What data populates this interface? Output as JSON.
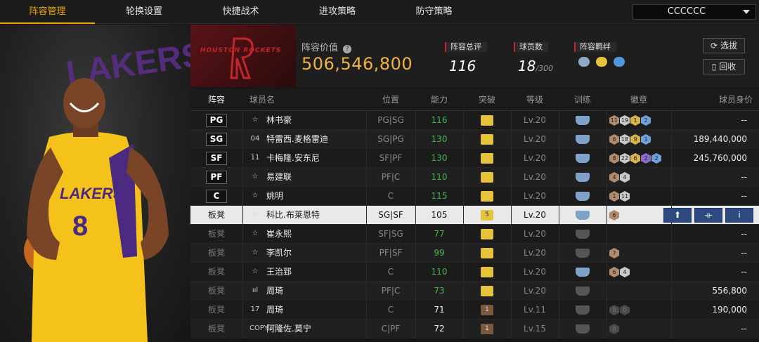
{
  "nav": {
    "tabs": [
      "阵容管理",
      "轮换设置",
      "快捷战术",
      "进攻策略",
      "防守策略"
    ],
    "active_tab": 0,
    "team_select": "CCCCCC"
  },
  "header": {
    "team_logo_text": "HOUSTON ROCKETS",
    "value_label": "阵容价值",
    "value": "506,546,800",
    "stats": [
      {
        "label": "阵容总评",
        "value": "116",
        "sub": ""
      },
      {
        "label": "球员数",
        "value": "18",
        "sub": "/300"
      },
      {
        "label": "阵容羁绊",
        "value": "",
        "sub": ""
      }
    ],
    "buttons": {
      "select": "选拔",
      "recycle": "回收"
    }
  },
  "table": {
    "columns": [
      "阵容",
      "球员名",
      "位置",
      "能力",
      "突破",
      "等级",
      "训练",
      "徽章",
      "球员身价"
    ],
    "rows": [
      {
        "slot": "PG",
        "starter": true,
        "icon": "☆",
        "name": "林书豪",
        "position": "PG|SG",
        "ability": "116",
        "ability_green": true,
        "break": "",
        "break_type": "gold",
        "level": "Lv.20",
        "train": "blue",
        "badges": [
          [
            "11",
            "b-bronze"
          ],
          [
            "19",
            "b-silver"
          ],
          [
            "1",
            "b-gold"
          ],
          [
            "2",
            "b-blue"
          ]
        ],
        "value": "--"
      },
      {
        "slot": "SG",
        "starter": true,
        "icon": "04",
        "name": "特雷西.麦格雷迪",
        "position": "SG|PG",
        "ability": "130",
        "ability_green": true,
        "break": "",
        "break_type": "gold",
        "level": "Lv.20",
        "train": "blue",
        "badges": [
          [
            "6",
            "b-bronze"
          ],
          [
            "18",
            "b-silver"
          ],
          [
            "9",
            "b-gold"
          ],
          [
            "1",
            "b-blue"
          ]
        ],
        "value": "189,440,000"
      },
      {
        "slot": "SF",
        "starter": true,
        "icon": "11",
        "name": "卡梅隆.安东尼",
        "position": "SF|PF",
        "ability": "130",
        "ability_green": true,
        "break": "",
        "break_type": "gold",
        "level": "Lv.20",
        "train": "blue",
        "badges": [
          [
            "8",
            "b-bronze"
          ],
          [
            "22",
            "b-silver"
          ],
          [
            "6",
            "b-gold"
          ],
          [
            "2",
            "b-purple"
          ],
          [
            "2",
            "b-blue"
          ]
        ],
        "value": "245,760,000"
      },
      {
        "slot": "PF",
        "starter": true,
        "icon": "☆",
        "name": "易建联",
        "position": "PF|C",
        "ability": "110",
        "ability_green": true,
        "break": "",
        "break_type": "gold",
        "level": "Lv.20",
        "train": "blue",
        "badges": [
          [
            "4",
            "b-bronze"
          ],
          [
            "4",
            "b-silver"
          ]
        ],
        "value": "--"
      },
      {
        "slot": "C",
        "starter": true,
        "icon": "☆",
        "name": "姚明",
        "position": "C",
        "ability": "115",
        "ability_green": true,
        "break": "",
        "break_type": "gold",
        "level": "Lv.20",
        "train": "blue",
        "badges": [
          [
            "1",
            "b-bronze"
          ],
          [
            "11",
            "b-silver"
          ]
        ],
        "value": "--"
      },
      {
        "slot": "板凳",
        "starter": false,
        "selected": true,
        "icon": "☆",
        "name": "科比.布莱恩特",
        "position": "SG|SF",
        "ability": "105",
        "ability_green": false,
        "break": "5",
        "break_type": "gold",
        "level": "Lv.20",
        "train": "blue",
        "badges": [
          [
            "6",
            "b-bronze"
          ]
        ],
        "value": ""
      },
      {
        "slot": "板凳",
        "starter": false,
        "icon": "☆",
        "name": "崔永熙",
        "position": "SF|SG",
        "ability": "77",
        "ability_green": true,
        "break": "",
        "break_type": "gold",
        "level": "Lv.20",
        "train": "gray",
        "badges": [],
        "value": "--"
      },
      {
        "slot": "板凳",
        "starter": false,
        "icon": "☆",
        "name": "李凯尔",
        "position": "PF|SF",
        "ability": "99",
        "ability_green": true,
        "break": "",
        "break_type": "gold",
        "level": "Lv.20",
        "train": "gray",
        "badges": [
          [
            "7",
            "b-bronze"
          ]
        ],
        "value": "--"
      },
      {
        "slot": "板凳",
        "starter": false,
        "icon": "☆",
        "name": "王治郅",
        "position": "C",
        "ability": "110",
        "ability_green": true,
        "break": "",
        "break_type": "gold",
        "level": "Lv.20",
        "train": "blue",
        "badges": [
          [
            "6",
            "b-bronze"
          ],
          [
            "4",
            "b-silver"
          ]
        ],
        "value": "--"
      },
      {
        "slot": "板凳",
        "starter": false,
        "icon": "ııl",
        "name": "周琦",
        "position": "PF|C",
        "ability": "73",
        "ability_green": true,
        "break": "",
        "break_type": "gold",
        "level": "Lv.20",
        "train": "gray",
        "badges": [],
        "value": "556,800"
      },
      {
        "slot": "板凳",
        "starter": false,
        "icon": "17",
        "name": "周琦",
        "position": "C",
        "ability": "71",
        "ability_green": false,
        "break": "1",
        "break_type": "brown",
        "level": "Lv.11",
        "train": "gray",
        "badges": [
          [
            "0",
            "b-dark"
          ],
          [
            "0",
            "b-dark"
          ]
        ],
        "value": "190,000"
      },
      {
        "slot": "板凳",
        "starter": false,
        "icon": "COPY",
        "name": "阿隆佐.莫宁",
        "position": "C|PF",
        "ability": "72",
        "ability_green": false,
        "break": "1",
        "break_type": "brown",
        "level": "Lv.15",
        "train": "gray",
        "badges": [
          [
            "0",
            "b-dark"
          ]
        ],
        "value": "--"
      }
    ]
  },
  "colors": {
    "accent": "#f0a500",
    "value_gold": "#f0b342",
    "green": "#44b64a",
    "action_blue": "#2d4a80"
  }
}
